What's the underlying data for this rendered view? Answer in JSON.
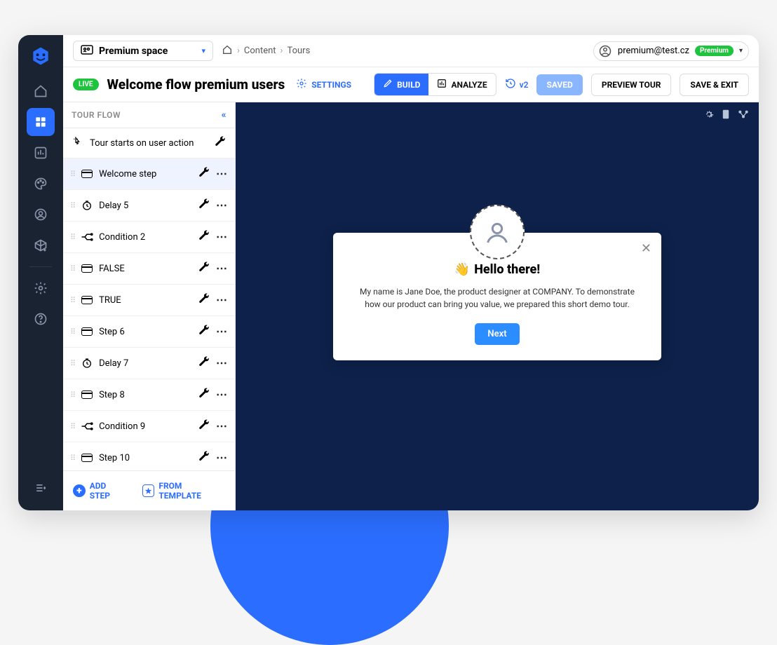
{
  "space": {
    "label": "Premium space"
  },
  "breadcrumb": {
    "content": "Content",
    "tours": "Tours"
  },
  "user": {
    "email": "premium@test.cz",
    "plan": "Premium"
  },
  "header": {
    "live_badge": "LIVE",
    "title": "Welcome flow premium users",
    "settings_label": "SETTINGS",
    "build_label": "BUILD",
    "analyze_label": "ANALYZE",
    "version": "v2",
    "saved_label": "SAVED",
    "preview_label": "PREVIEW TOUR",
    "save_exit_label": "SAVE & EXIT"
  },
  "flow": {
    "panel_title": "TOUR FLOW",
    "start_text": "Tour starts on user action",
    "steps": [
      {
        "label": "Welcome step",
        "type": "card",
        "active": true
      },
      {
        "label": "Delay 5",
        "type": "delay"
      },
      {
        "label": "Condition 2",
        "type": "condition"
      },
      {
        "label": "FALSE",
        "type": "card"
      },
      {
        "label": "TRUE",
        "type": "card"
      },
      {
        "label": "Step 6",
        "type": "card"
      },
      {
        "label": "Delay 7",
        "type": "delay"
      },
      {
        "label": "Step 8",
        "type": "card"
      },
      {
        "label": "Condition 9",
        "type": "condition"
      },
      {
        "label": "Step 10",
        "type": "card"
      }
    ],
    "add_step_label": "ADD STEP",
    "from_template_label": "FROM TEMPLATE"
  },
  "popup": {
    "wave": "👋",
    "title": "Hello there!",
    "body": "My name is Jane Doe, the product designer at COMPANY. To demonstrate how our product can bring you value, we prepared this short demo tour.",
    "button": "Next"
  },
  "icons": {
    "home": "home-icon",
    "grid": "grid-icon",
    "chart": "chart-icon",
    "palette": "palette-icon",
    "user": "user-icon",
    "cube": "cube-icon",
    "gear": "gear-icon",
    "help": "help-icon",
    "expand": "expand-icon"
  }
}
